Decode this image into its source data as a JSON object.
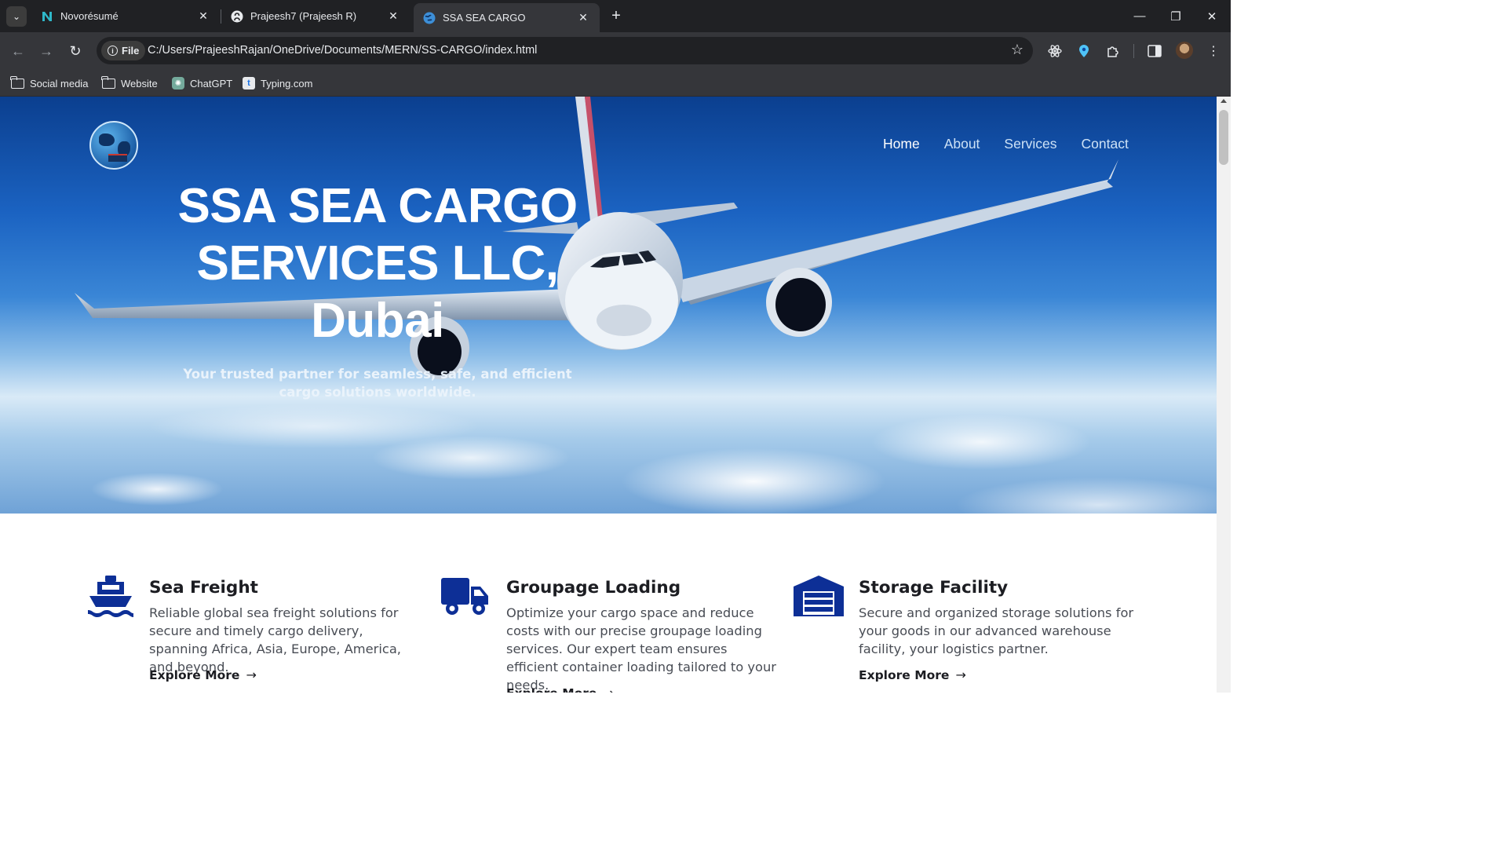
{
  "browser": {
    "tabs": [
      {
        "title": "Novorésumé",
        "icon": "novoresume-icon"
      },
      {
        "title": "Prajeesh7 (Prajeesh R)",
        "icon": "github-icon"
      },
      {
        "title": "SSA SEA CARGO",
        "icon": "globe-icon"
      }
    ],
    "new_tab": "+",
    "address_chip": "File",
    "url": "C:/Users/PrajeeshRajan/OneDrive/Documents/MERN/SS-CARGO/index.html",
    "bookmarks": [
      {
        "label": "Social media",
        "icon": "folder-icon"
      },
      {
        "label": "Website",
        "icon": "folder-icon"
      },
      {
        "label": "ChatGPT",
        "icon": "chatgpt-icon"
      },
      {
        "label": "Typing.com",
        "icon": "typing-icon"
      }
    ]
  },
  "page": {
    "nav": {
      "items": [
        "Home",
        "About",
        "Services",
        "Contact"
      ],
      "active": "Home"
    },
    "hero": {
      "title": "SSA SEA CARGO SERVICES LLC, Dubai",
      "subtitle": "Your trusted partner for seamless, safe, and efficient cargo solutions worldwide."
    },
    "services": [
      {
        "icon": "ship-icon",
        "title": "Sea Freight",
        "description": "Reliable global sea freight solutions for secure and timely cargo delivery, spanning Africa, Asia, Europe, America, and beyond.",
        "link": "Explore More"
      },
      {
        "icon": "truck-icon",
        "title": "Groupage Loading",
        "description": "Optimize your cargo space and reduce costs with our precise groupage loading services. Our expert team ensures efficient container loading tailored to your needs.",
        "link": "Explore More"
      },
      {
        "icon": "warehouse-icon",
        "title": "Storage Facility",
        "description": "Secure and organized storage solutions for your goods in our advanced warehouse facility, your logistics partner.",
        "link": "Explore More"
      }
    ],
    "colors": {
      "icon_blue": "#0d2f96",
      "heading": "#1c1d22",
      "body_text": "#484c54",
      "browser_dark": "#202124",
      "browser_toolbar": "#35363a"
    }
  }
}
